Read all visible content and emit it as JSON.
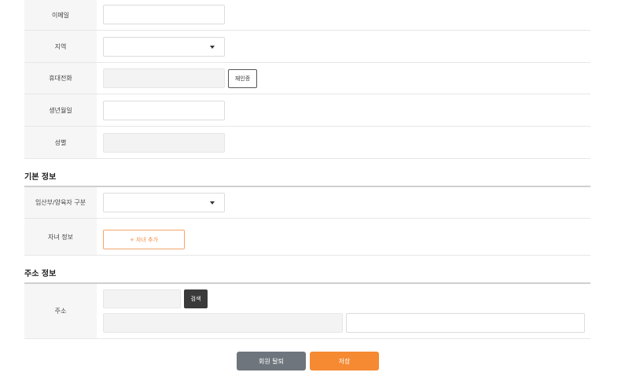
{
  "personal": {
    "email_label": "이메일",
    "region_label": "지역",
    "phone_label": "휴대전화",
    "reauth_button": "재인증",
    "birth_label": "생년월일",
    "gender_label": "성별"
  },
  "basic_info": {
    "title": "기본 정보",
    "pregnancy_label": "임산부/양육자 구분",
    "children_label": "자녀 정보",
    "add_child_button": "+ 자녀 추가"
  },
  "address_info": {
    "title": "주소 정보",
    "address_label": "주소",
    "search_button": "검색"
  },
  "actions": {
    "withdraw_button": "회원 탈퇴",
    "save_button": "저장"
  },
  "colors": {
    "accent": "#f58a33",
    "withdraw": "#6e757c",
    "dark_button": "#3a3a3a"
  }
}
